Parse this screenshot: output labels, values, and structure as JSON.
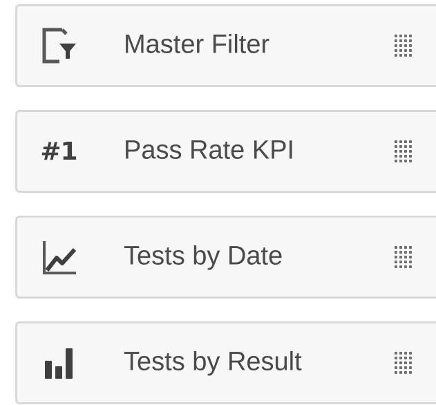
{
  "items": [
    {
      "label": "Master Filter",
      "icon": "filter-pane-icon"
    },
    {
      "label": "Pass Rate KPI",
      "icon": "kpi-icon",
      "icon_text": "#1"
    },
    {
      "label": "Tests by Date",
      "icon": "line-chart-icon"
    },
    {
      "label": "Tests by Result",
      "icon": "bar-chart-icon"
    }
  ],
  "colors": {
    "card_background": "#f7f7f7",
    "card_border": "#d9d9d9",
    "text": "#4a4a4a",
    "icon": "#595959"
  }
}
